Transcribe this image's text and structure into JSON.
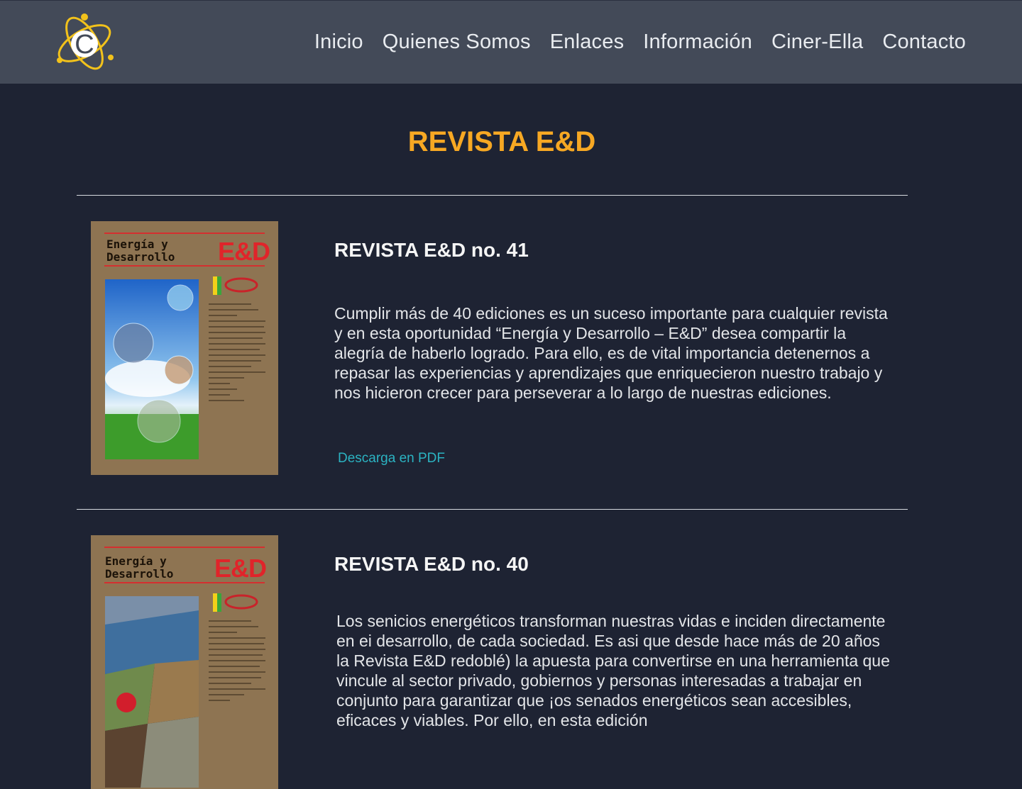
{
  "nav": {
    "logo_letter": "C",
    "items": [
      "Inicio",
      "Quienes Somos",
      "Enlaces",
      "Información",
      "Ciner-Ella",
      "Contacto"
    ]
  },
  "page": {
    "title": "REVISTA E&D"
  },
  "issues": [
    {
      "title": "REVISTA E&D no. 41",
      "description": "Cumplir más de 40 ediciones es un suceso importante para cualquier revista y en esta oportunidad “Energía y Desarrollo – E&D” desea compartir la alegría de haberlo logrado. Para ello, es de vital importancia detenernos a repasar las experiencias y aprendizajes que enriquecieron nuestro trabajo y nos hicieron crecer para perseverar a lo largo de nuestras ediciones.",
      "download_label": "Descarga en PDF",
      "cover": {
        "heading": "Energía y Desarrollo",
        "logo": "E&D"
      }
    },
    {
      "title": "REVISTA E&D no. 40",
      "description": "Los senicios energéticos transforman nuestras vidas e inciden directamente en ei desarrollo, de cada sociedad. Es asi que desde hace más de 20 años la Revista E&D redoblé) la apuesta para convertirse en una herramienta que vincule al sector privado, gobiernos y personas interesadas a trabajar en conjunto para garantizar que ¡os senados energéticos sean accesibles, eficaces y viables. Por ello, en esta edición",
      "cover": {
        "heading": "Energía y Desarrollo",
        "logo": "E&D"
      }
    }
  ],
  "colors": {
    "navbar_bg": "#434a58",
    "page_bg": "#1e2333",
    "title_accent": "#f7a823",
    "link": "#2bb3c2",
    "logo_gold": "#f2c21b"
  }
}
